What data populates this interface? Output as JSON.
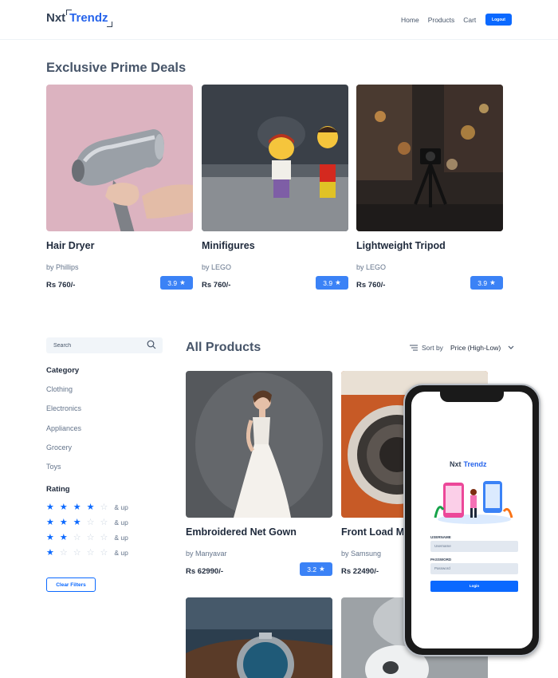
{
  "navbar": {
    "logo_prefix": "Nxt",
    "logo_suffix": "Trendz",
    "links": [
      "Home",
      "Products",
      "Cart"
    ],
    "logout": "Logout"
  },
  "prime": {
    "title": "Exclusive Prime Deals",
    "cards": [
      {
        "name": "Hair Dryer",
        "brand": "by Phillips",
        "price": "Rs 760/-",
        "rating": "3.9"
      },
      {
        "name": "Minifigures",
        "brand": "by LEGO",
        "price": "Rs 760/-",
        "rating": "3.9"
      },
      {
        "name": "Lightweight Tripod",
        "brand": "by LEGO",
        "price": "Rs 760/-",
        "rating": "3.9"
      }
    ]
  },
  "filters": {
    "search_placeholder": "Search",
    "category_title": "Category",
    "categories": [
      "Clothing",
      "Electronics",
      "Appliances",
      "Grocery",
      "Toys"
    ],
    "rating_title": "Rating",
    "rating_suffix": "& up",
    "ratings": [
      4,
      3,
      2,
      1
    ],
    "clear_label": "Clear Filters"
  },
  "products": {
    "title": "All Products",
    "sort_label": "Sort by",
    "sort_value": "Price (High-Low)",
    "cards": [
      {
        "name": "Embroidered Net Gown",
        "brand": "by Manyavar",
        "price": "Rs 62990/-",
        "rating": "3.2"
      },
      {
        "name": "Front Load Ma",
        "brand": "by Samsung",
        "price": "Rs 22490/-"
      }
    ]
  },
  "phone": {
    "logo_prefix": "Nxt",
    "logo_suffix": "Trendz",
    "username_label": "USERNAME",
    "username_placeholder": "Username",
    "password_label": "PASSWORD",
    "password_placeholder": "Password",
    "login_label": "Login"
  },
  "colors": {
    "accent": "#0b69ff",
    "rating_badge": "#3b82f6",
    "star": "#0b69ff",
    "star_empty": "#cbd5e1"
  }
}
